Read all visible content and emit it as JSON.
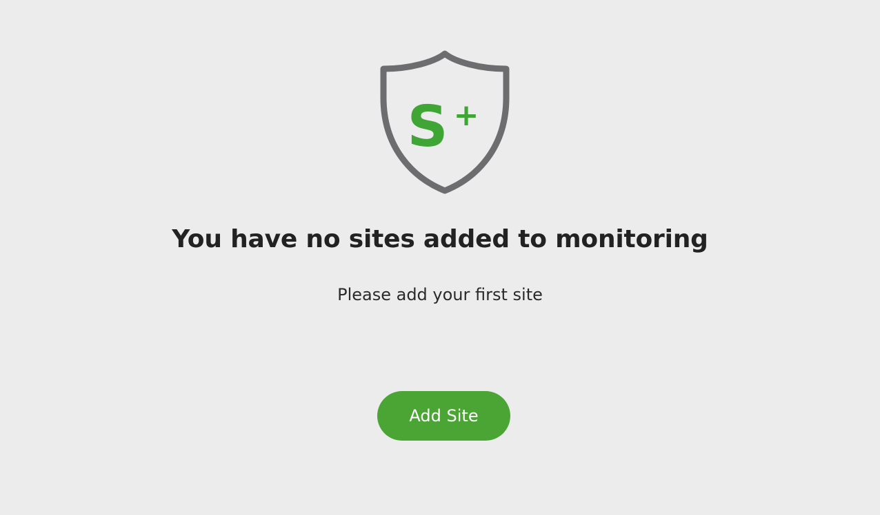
{
  "logo": {
    "icon": "shield-icon",
    "letter": "S",
    "plus": "+",
    "shield_color": "#6d6d70",
    "accent_color": "#3fa535"
  },
  "empty_state": {
    "title": "You have no sites added to monitoring",
    "subtitle": "Please add your first site"
  },
  "actions": {
    "add_site_label": "Add Site",
    "button_color": "#4aa534"
  }
}
